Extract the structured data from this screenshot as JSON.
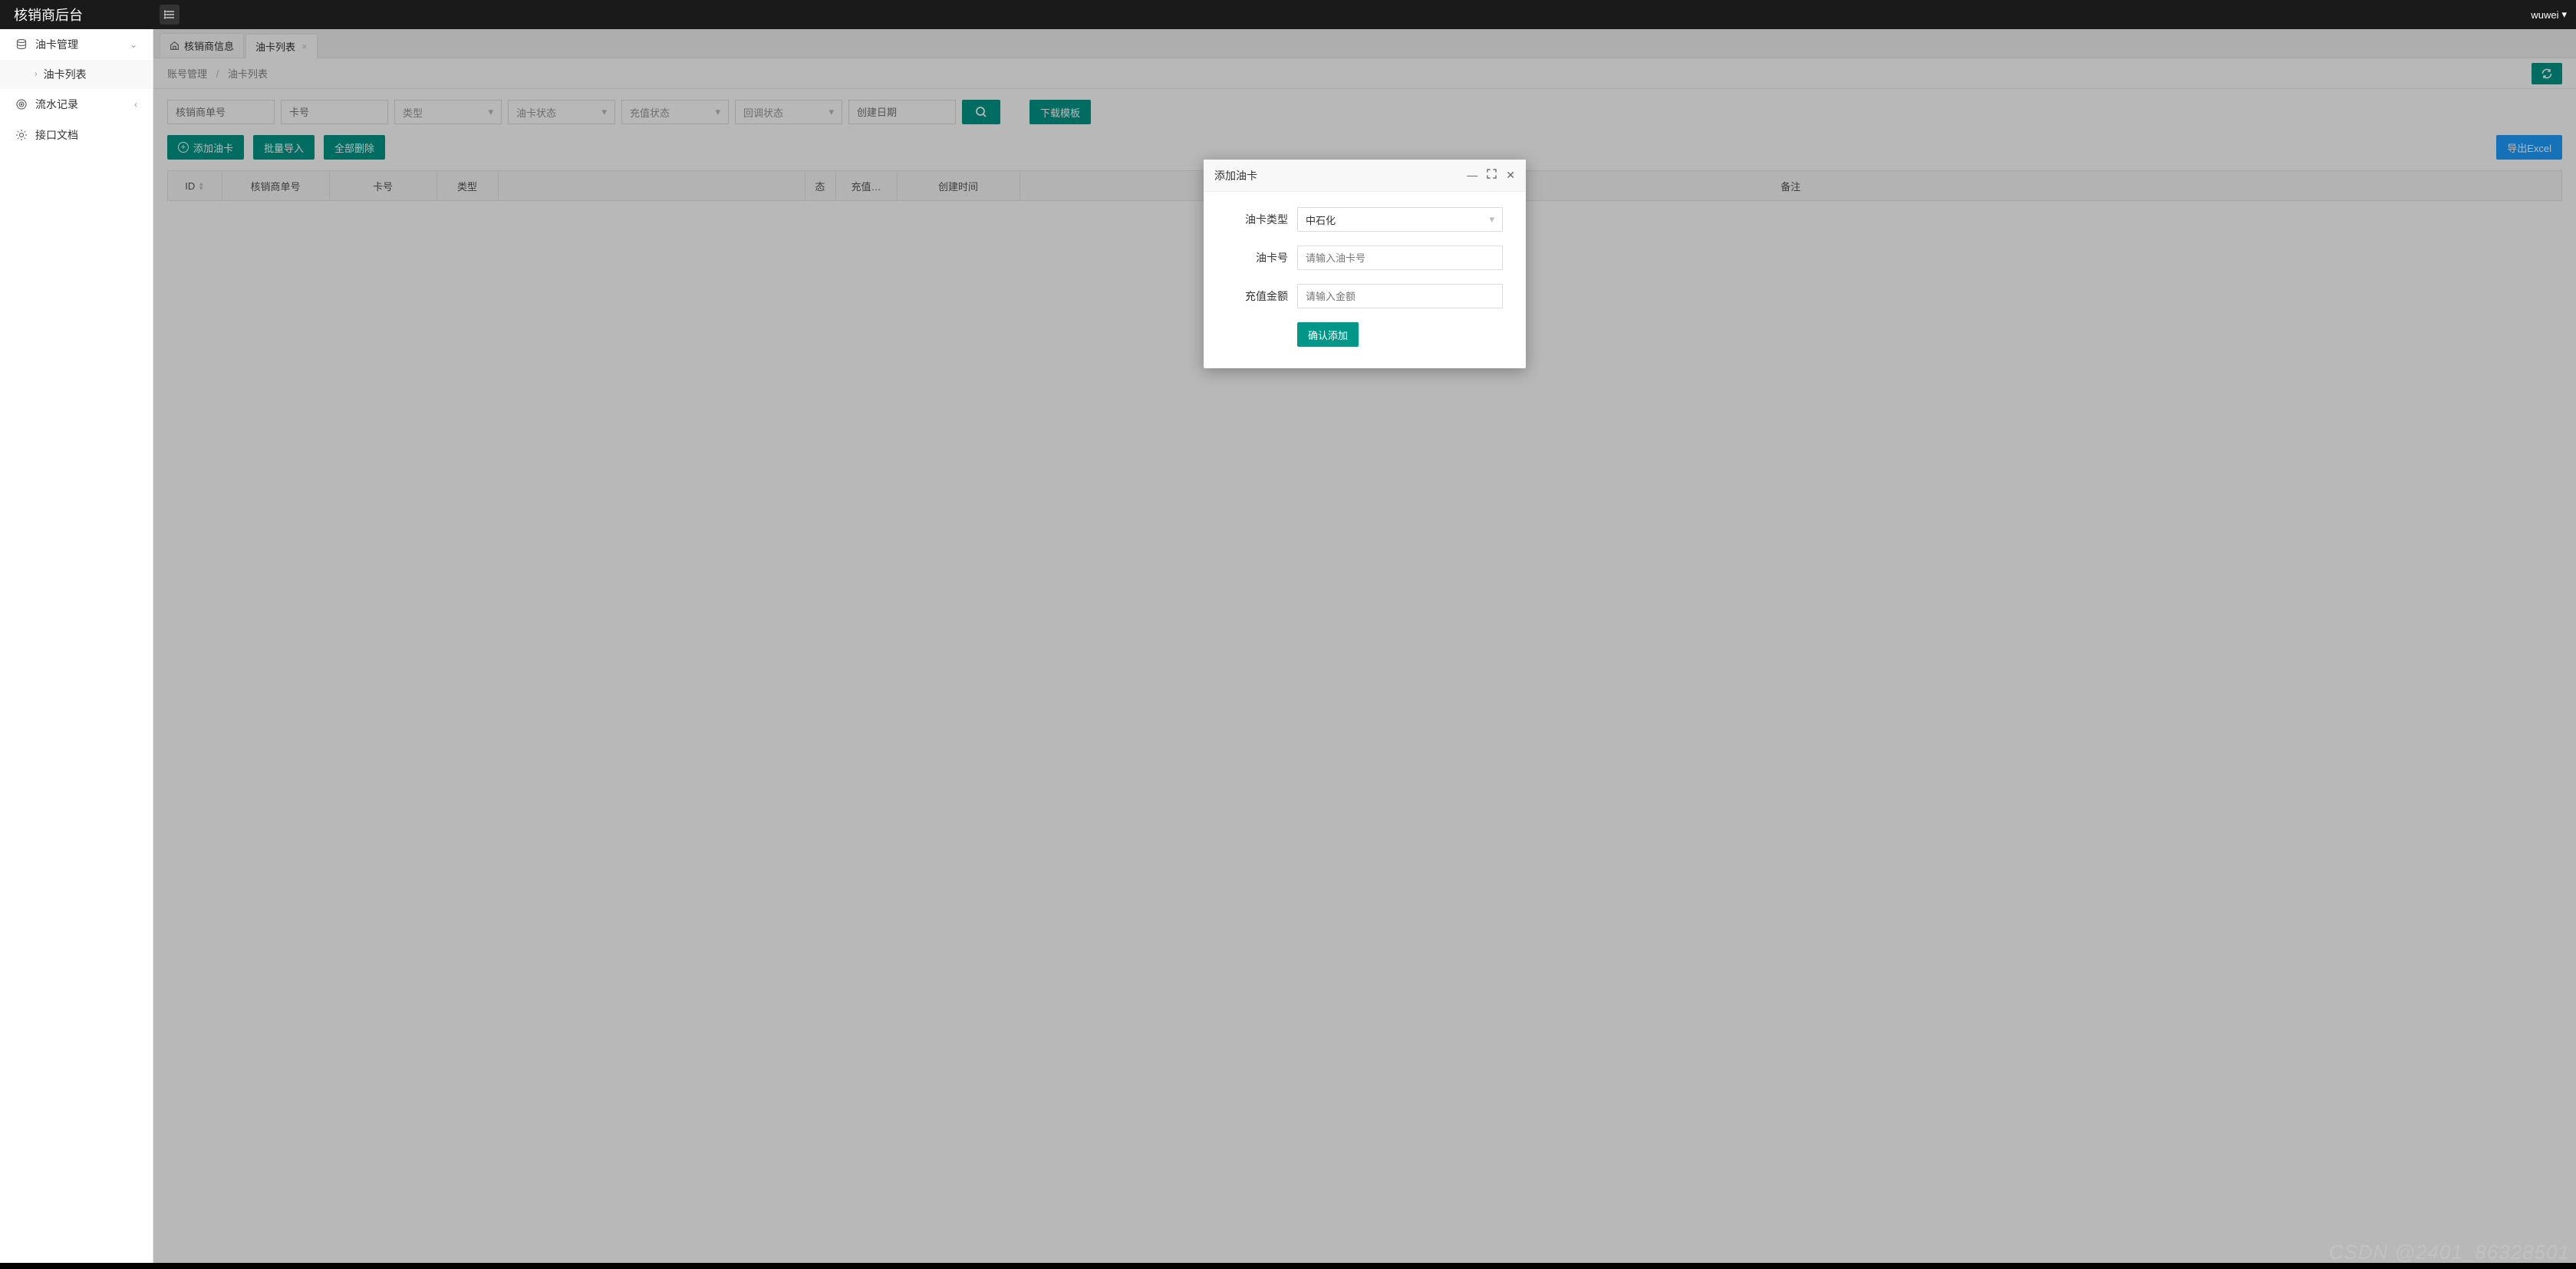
{
  "header": {
    "title": "核销商后台",
    "user": "wuwei"
  },
  "sidebar": {
    "items": [
      {
        "label": "油卡管理",
        "icon": "db",
        "expanded": true,
        "children": [
          {
            "label": "油卡列表"
          }
        ]
      },
      {
        "label": "流水记录",
        "icon": "target",
        "expanded": false
      },
      {
        "label": "接口文档",
        "icon": "gear"
      }
    ]
  },
  "tabs": [
    {
      "label": "核销商信息",
      "closable": false,
      "home": true
    },
    {
      "label": "油卡列表",
      "closable": true,
      "active": true
    }
  ],
  "breadcrumb": {
    "root": "账号管理",
    "current": "油卡列表"
  },
  "filters": {
    "merchant_no_placeholder": "核销商单号",
    "card_no_placeholder": "卡号",
    "type_placeholder": "类型",
    "card_status_placeholder": "油卡状态",
    "recharge_status_placeholder": "充值状态",
    "callback_status_placeholder": "回调状态",
    "create_date_placeholder": "创建日期",
    "download_template_label": "下载模板"
  },
  "actions": {
    "add_card_label": "添加油卡",
    "bulk_import_label": "批量导入",
    "delete_all_label": "全部删除",
    "export_excel_label": "导出Excel"
  },
  "table": {
    "columns": [
      "ID",
      "核销商单号",
      "卡号",
      "类型",
      "",
      "态",
      "充值…",
      "创建时间",
      "备注"
    ]
  },
  "dialog": {
    "title": "添加油卡",
    "fields": {
      "type_label": "油卡类型",
      "type_value": "中石化",
      "card_label": "油卡号",
      "card_placeholder": "请输入油卡号",
      "amount_label": "充值金额",
      "amount_placeholder": "请输入金额"
    },
    "confirm_label": "确认添加"
  },
  "watermark": "CSDN @2401_86328501"
}
